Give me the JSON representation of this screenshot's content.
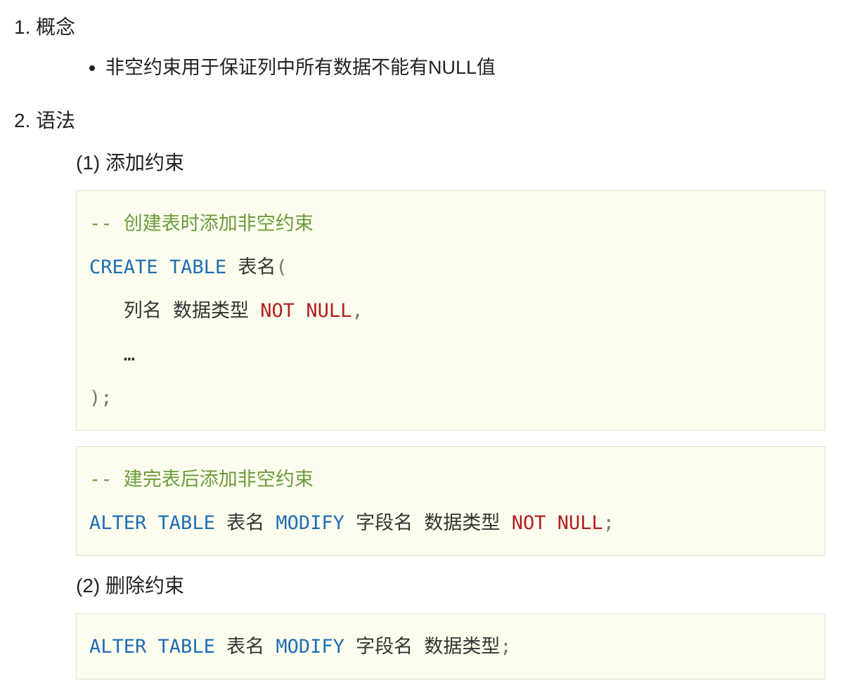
{
  "sec1": {
    "heading": "1. 概念",
    "bullet": "非空约束用于保证列中所有数据不能有NULL值"
  },
  "sec2": {
    "heading": "2. 语法",
    "sub1": {
      "heading": "(1)  添加约束"
    },
    "sub2": {
      "heading": "(2)  删除约束"
    }
  },
  "code1": {
    "c1": "-- 创建表时添加非空约束",
    "l2_kw1": "CREATE",
    "l2_kw2": "TABLE",
    "l2_name": "表名",
    "l2_open": "(",
    "l3_col": "   列名 数据类型 ",
    "l3_nn1": "NOT",
    "l3_nn2": "NULL",
    "l3_comma": ",",
    "l4_dots": "   …",
    "l5_close": ");"
  },
  "code2": {
    "c1": "-- 建完表后添加非空约束",
    "kw1": "ALTER",
    "kw2": "TABLE",
    "name": "表名 ",
    "kw3": "MODIFY",
    "mid": " 字段名 数据类型 ",
    "nn1": "NOT",
    "nn2": "NULL",
    "semi": ";"
  },
  "code3": {
    "kw1": "ALTER",
    "kw2": "TABLE",
    "name": "表名 ",
    "kw3": "MODIFY",
    "mid": " 字段名 数据类型",
    "semi": ";"
  }
}
